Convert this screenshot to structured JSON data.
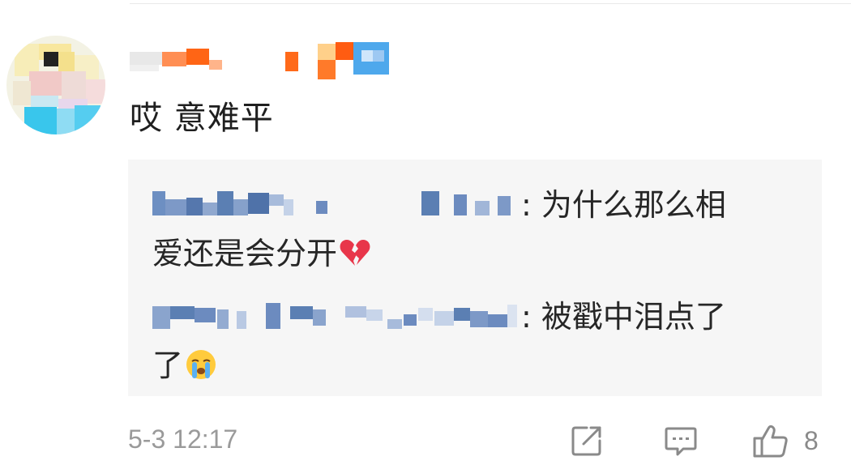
{
  "comment": {
    "text": "哎 意难平",
    "timestamp": "5-3 12:17",
    "like_count": "8"
  },
  "replies": [
    {
      "text_line1": ": 为什么那么相",
      "text_line2": "爱还是会分开",
      "emoji": "broken-heart"
    },
    {
      "text_line1": ": 被戳中泪点了",
      "text_line2": "了",
      "emoji": "crying-face"
    }
  ],
  "icons": {
    "share": "share-icon",
    "comment": "comment-icon",
    "like": "thumbs-up-icon"
  },
  "colors": {
    "background": "#ffffff",
    "reply_box": "#f6f6f6",
    "muted_text": "#9a9a9a",
    "mosaic_blue": "#5b7fb3",
    "mosaic_orange": "#ff6a1a"
  }
}
